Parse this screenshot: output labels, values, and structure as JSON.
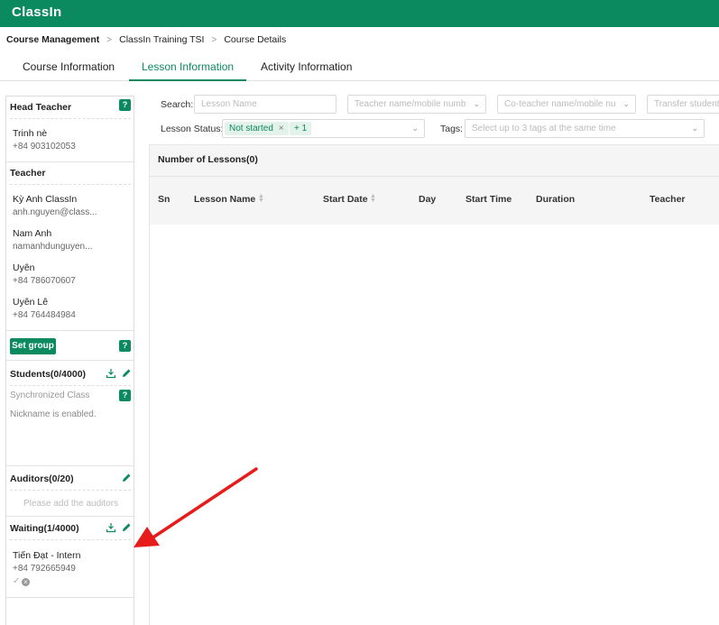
{
  "app": {
    "logo": "ClassIn"
  },
  "breadcrumb": [
    "Course Management",
    "ClassIn Training TSI",
    "Course Details"
  ],
  "breadcrumb_separator": ">",
  "tabs": [
    {
      "label": "Course Information",
      "active": false
    },
    {
      "label": "Lesson Information",
      "active": true
    },
    {
      "label": "Activity Information",
      "active": false
    }
  ],
  "sidebar": {
    "head_teacher": {
      "title": "Head Teacher",
      "help": "?",
      "name": "Trinh nè",
      "phone": "+84 903102053"
    },
    "teacher": {
      "title": "Teacher",
      "people": [
        {
          "name": "Kỳ Anh ClassIn",
          "detail": "anh.nguyen@class..."
        },
        {
          "name": "Nam Anh",
          "detail": "namanhdunguyen..."
        },
        {
          "name": "Uyên",
          "detail": "+84 786070607"
        },
        {
          "name": "Uyên Lê",
          "detail": "+84 764484984"
        }
      ]
    },
    "set_group": {
      "label": "Set group",
      "help": "?"
    },
    "students": {
      "title": "Students(0/4000)",
      "synchronized": "Synchronized Class",
      "help": "?",
      "nickname": "Nickname is enabled."
    },
    "auditors": {
      "title": "Auditors(0/20)",
      "empty": "Please add the auditors"
    },
    "waiting": {
      "title": "Waiting(1/4000)",
      "name": "Tiến Đạt - Intern",
      "phone": "+84 792665949",
      "approve_glyph": "✓",
      "reject_glyph": "×"
    }
  },
  "filters": {
    "search_label": "Search:",
    "lesson_name_placeholder": "Lesson Name",
    "teacher_placeholder": "Teacher name/mobile numb",
    "coteacher_placeholder": "Co-teacher name/mobile nu",
    "transfer_placeholder": "Transfer student",
    "lesson_status_label": "Lesson Status:",
    "status_tag": "Not started",
    "status_tag_close": "×",
    "status_more": "+ 1",
    "tags_label": "Tags:",
    "tags_placeholder": "Select up to 3 tags at the same time"
  },
  "table": {
    "count_label": "Number of Lessons(0)",
    "columns": [
      "Sn",
      "Lesson Name",
      "Start Date",
      "Day",
      "Start Time",
      "Duration",
      "Teacher"
    ],
    "sortable_columns": [
      "Lesson Name",
      "Start Date"
    ],
    "rows": []
  },
  "icons": {
    "download": "download-icon",
    "edit": "pencil-icon",
    "chevron": "chevron-down-icon"
  },
  "colors": {
    "brand": "#0b8a5f",
    "annotation_arrow": "#e81b1b"
  }
}
